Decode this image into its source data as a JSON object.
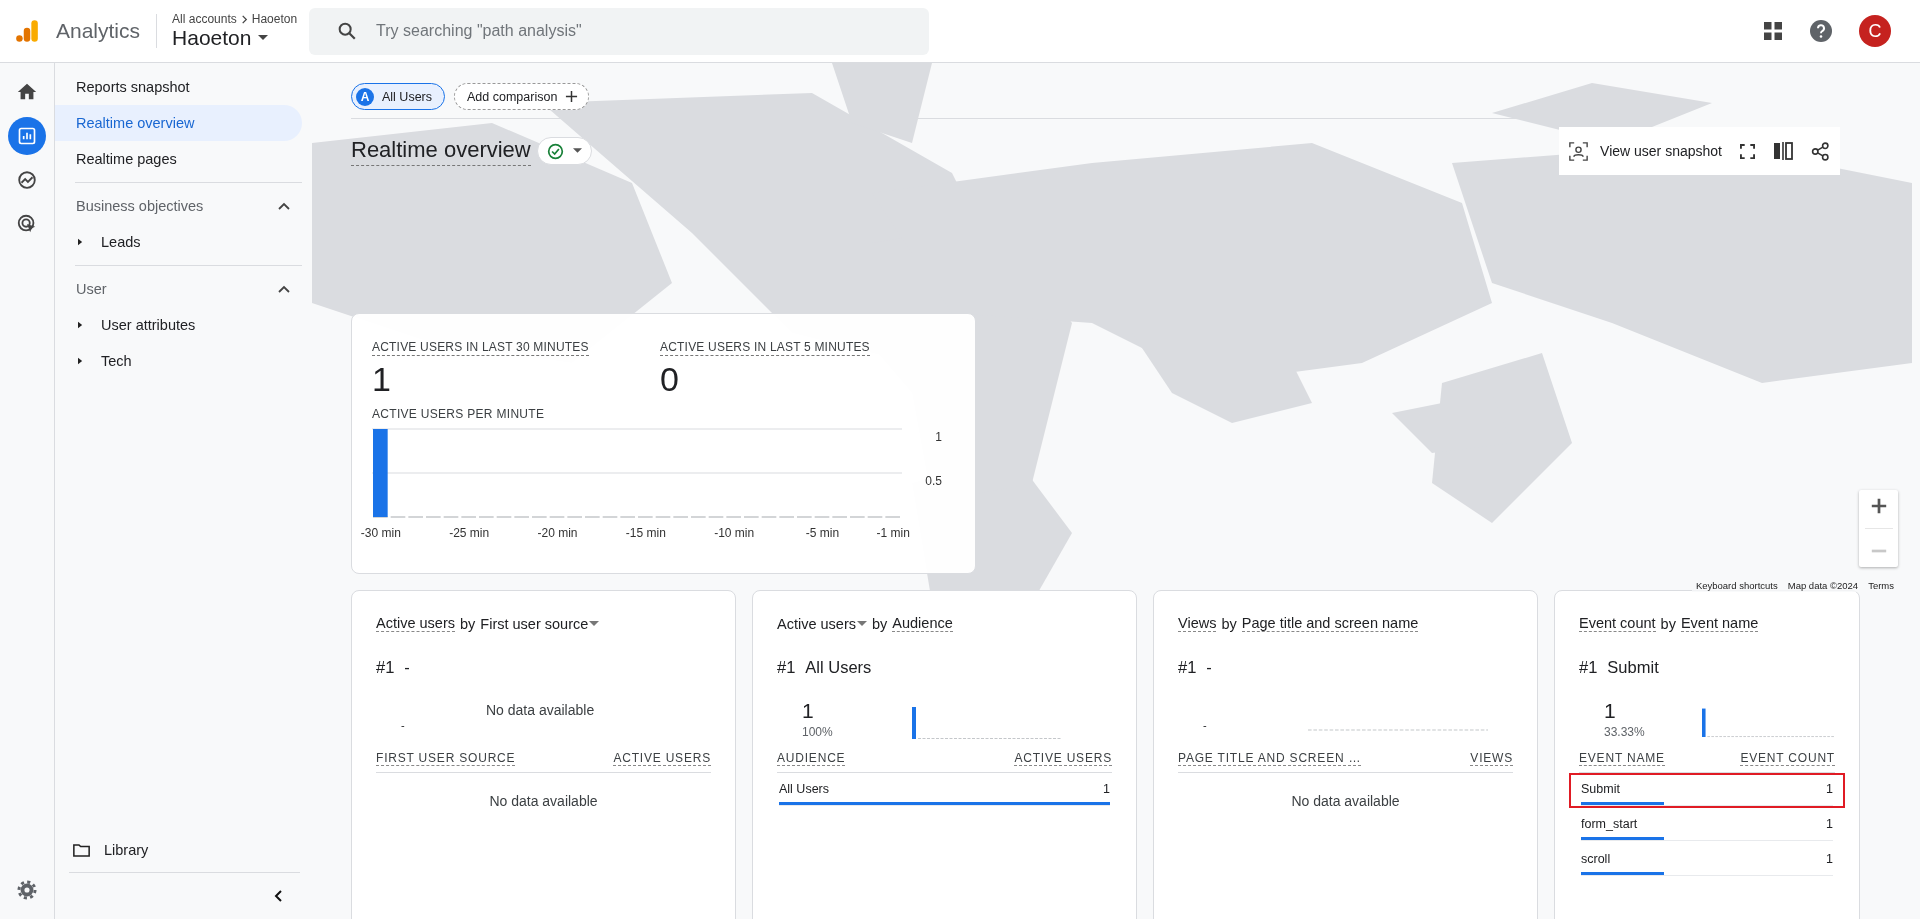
{
  "top_bar": {
    "product": "Analytics",
    "breadcrumb": [
      "All accounts",
      "Haoeton"
    ],
    "property": "Haoeton",
    "search": {
      "placeholder": "Try searching \"path analysis\""
    },
    "avatar": "C"
  },
  "rail": [
    {
      "kind": "home",
      "selected": false
    },
    {
      "kind": "reports",
      "selected": true
    },
    {
      "kind": "explore",
      "selected": false
    },
    {
      "kind": "advertising",
      "selected": false
    }
  ],
  "nav": {
    "items": [
      {
        "label": "Reports snapshot",
        "selected": false
      },
      {
        "label": "Realtime overview",
        "selected": true
      },
      {
        "label": "Realtime pages",
        "selected": false
      }
    ],
    "sections": [
      {
        "title": "Business objectives",
        "expanded": true,
        "children": [
          {
            "label": "Leads",
            "expanded": false
          }
        ]
      },
      {
        "title": "User",
        "expanded": true,
        "children": [
          {
            "label": "User attributes",
            "expanded": false
          },
          {
            "label": "Tech",
            "expanded": false
          }
        ]
      }
    ],
    "library": "Library"
  },
  "comparisons": [
    {
      "badge": "A",
      "label": "All Users",
      "kind": "segment"
    },
    {
      "label": "Add comparison",
      "kind": "add"
    }
  ],
  "header": {
    "title": "Realtime overview",
    "status_ok": true,
    "tools": [
      {
        "kind": "snapshot",
        "label": "View user snapshot"
      },
      {
        "kind": "fullscreen"
      },
      {
        "kind": "compare"
      },
      {
        "kind": "share"
      }
    ]
  },
  "map": {
    "kind": "picture",
    "attribution": [
      "Keyboard shortcuts",
      "Map data ©2024",
      "Terms"
    ]
  },
  "active_card": {
    "metrics": [
      {
        "label": "ACTIVE USERS IN LAST 30 MINUTES",
        "value": "1"
      },
      {
        "label": "ACTIVE USERS IN LAST 5 MINUTES",
        "value": "0"
      }
    ],
    "chart_title": "ACTIVE USERS PER MINUTE",
    "chart_data": {
      "type": "bar",
      "x": [
        -30,
        -29,
        -28,
        -27,
        -26,
        -25,
        -24,
        -23,
        -22,
        -21,
        -20,
        -19,
        -18,
        -17,
        -16,
        -15,
        -14,
        -13,
        -12,
        -11,
        -10,
        -9,
        -8,
        -7,
        -6,
        -5,
        -4,
        -3,
        -2,
        -1
      ],
      "series": [
        {
          "color": "#1a73e8",
          "values": [
            1,
            0,
            0,
            0,
            0,
            0,
            0,
            0,
            0,
            0,
            0,
            0,
            0,
            0,
            0,
            0,
            0,
            0,
            0,
            0,
            0,
            0,
            0,
            0,
            0,
            0,
            0,
            0,
            0,
            0
          ]
        }
      ],
      "xlim": [
        -30.5,
        -0.5
      ],
      "xticks": [
        {
          "value": -30,
          "label": "-30 min"
        },
        {
          "value": -25,
          "label": "-25 min"
        },
        {
          "value": -20,
          "label": "-20 min"
        },
        {
          "value": -15,
          "label": "-15 min"
        },
        {
          "value": -10,
          "label": "-10 min"
        },
        {
          "value": -5,
          "label": "-5 min"
        },
        {
          "value": -1,
          "label": "-1 min"
        }
      ],
      "yticks": [
        0.5,
        1
      ],
      "ylim": [
        0,
        1
      ]
    }
  },
  "cards": [
    {
      "metric": {
        "text": "Active users",
        "dropdown": false
      },
      "by": "by",
      "dimension": {
        "text": "First user source",
        "dropdown": true
      },
      "rank": "#1",
      "top_name": "-",
      "summary": {
        "kind": "message",
        "dash": "-",
        "message": "No data available"
      },
      "columns": [
        "FIRST USER SOURCE",
        "ACTIVE USERS"
      ],
      "empty": "No data available"
    },
    {
      "metric": {
        "text": "Active users",
        "dropdown": true
      },
      "by": "by",
      "dimension": {
        "text": "Audience",
        "dropdown": false
      },
      "rank": "#1",
      "top_name": "All Users",
      "summary": {
        "kind": "value",
        "value": "1",
        "share": "100%"
      },
      "columns": [
        "AUDIENCE",
        "ACTIVE USERS"
      ],
      "rows": [
        {
          "name": "All Users",
          "value": "1",
          "level": 1,
          "highlighted": false
        }
      ]
    },
    {
      "metric": {
        "text": "Views",
        "dropdown": false
      },
      "by": "by",
      "dimension": {
        "text": "Page title and screen name",
        "dropdown": false
      },
      "rank": "#1",
      "top_name": "-",
      "summary": {
        "kind": "line",
        "dash": "-"
      },
      "columns": [
        "PAGE TITLE AND SCREEN …",
        "VIEWS"
      ],
      "empty": "No data available"
    },
    {
      "metric": {
        "text": "Event count",
        "dropdown": false
      },
      "by": "by",
      "dimension": {
        "text": "Event name",
        "dropdown": false
      },
      "rank": "#1",
      "top_name": "Submit",
      "summary": {
        "kind": "value",
        "value": "1",
        "share": "33.33%"
      },
      "columns": [
        "EVENT NAME",
        "EVENT COUNT"
      ],
      "rows": [
        {
          "name": "Submit",
          "value": "1",
          "level": 0.33,
          "highlighted": true
        },
        {
          "name": "form_start",
          "value": "1",
          "level": 0.33,
          "highlighted": false
        },
        {
          "name": "scroll",
          "value": "1",
          "level": 0.33,
          "highlighted": false
        }
      ]
    }
  ]
}
